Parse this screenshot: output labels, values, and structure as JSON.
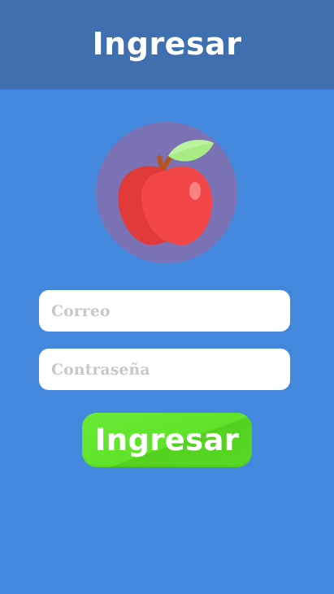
{
  "header": {
    "title": "Ingresar"
  },
  "logo": {
    "icon": "apple-icon"
  },
  "form": {
    "email_placeholder": "Correo",
    "email_value": "",
    "password_placeholder": "Contraseña",
    "password_value": "",
    "submit_label": "Ingresar"
  },
  "colors": {
    "background": "#4488DD",
    "header_bar": "#3F6FAF",
    "logo_circle": "#7B72B5",
    "apple_red": "#F24646",
    "leaf_green": "#A9EC85",
    "button_green": "#5FE32A"
  }
}
